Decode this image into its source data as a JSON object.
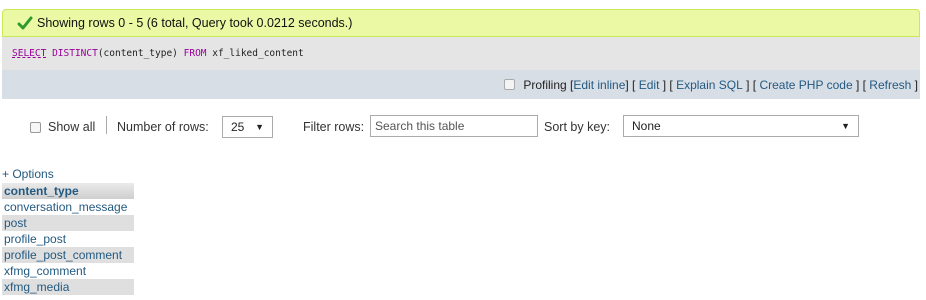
{
  "message": {
    "text": "Showing rows 0 - 5 (6 total, Query took 0.0212 seconds.)",
    "icon": "check-icon",
    "color": "#ebf8a4"
  },
  "sql": {
    "select": "SELECT",
    "distinct": "DISTINCT",
    "column": "(content_type) ",
    "from": "FROM",
    "table": " xf_liked_content"
  },
  "tools": {
    "profiling": "Profiling",
    "edit_inline": "Edit inline",
    "edit": "Edit",
    "explain_sql": "Explain SQL",
    "create_php": "Create PHP code",
    "refresh": "Refresh"
  },
  "navigation": {
    "show_all": "Show all",
    "number_of_rows_label": "Number of rows:",
    "number_of_rows_value": "25",
    "filter_label": "Filter rows:",
    "filter_placeholder": "Search this table",
    "sort_label": "Sort by key:",
    "sort_value": "None"
  },
  "options_link": "+ Options",
  "table": {
    "header": "content_type",
    "rows": [
      "conversation_message",
      "post",
      "profile_post",
      "profile_post_comment",
      "xfmg_comment",
      "xfmg_media"
    ]
  }
}
